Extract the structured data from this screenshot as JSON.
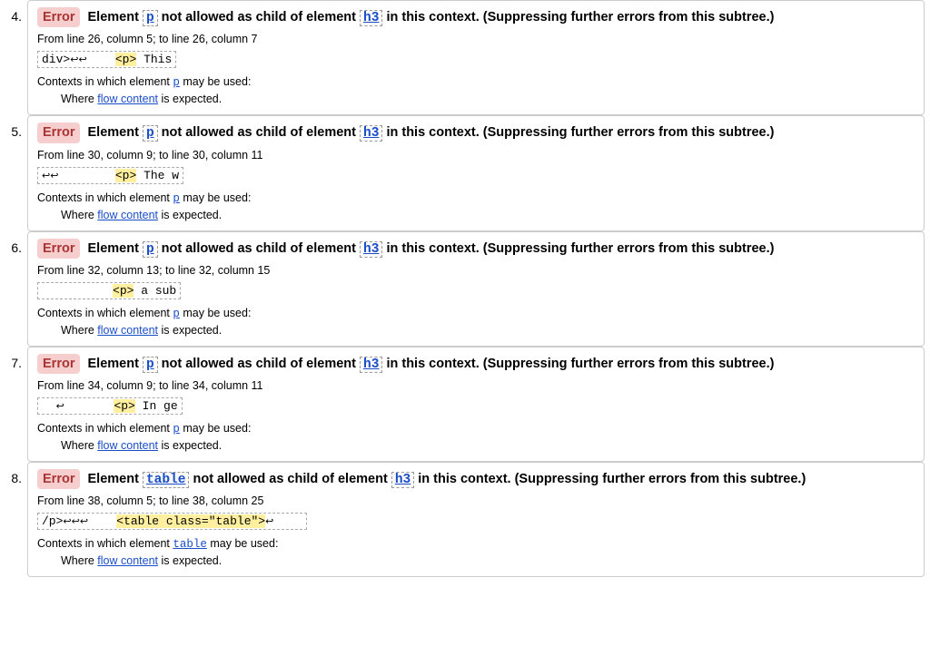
{
  "labels": {
    "error": "Error",
    "contexts_prefix": "Contexts in which element ",
    "contexts_suffix": " may be used:",
    "where": "Where ",
    "flow_content": "flow content",
    "is_expected": " is expected."
  },
  "msg_template": {
    "t1": "Element ",
    "t2": " not allowed as child of element ",
    "t3": " in this context. (Suppressing further errors from this subtree.)"
  },
  "items": [
    {
      "num": "4.",
      "el1": "p",
      "el2": "h3",
      "loc": "From line 26, column 5; to line 26, column 7",
      "extract_pre": "div>↩↩    ",
      "extract_hl": "<p>",
      "extract_post": " This",
      "ctx_el": "p"
    },
    {
      "num": "5.",
      "el1": "p",
      "el2": "h3",
      "loc": "From line 30, column 9; to line 30, column 11",
      "extract_pre": "↩↩        ",
      "extract_hl": "<p>",
      "extract_post": " The w",
      "ctx_el": "p"
    },
    {
      "num": "6.",
      "el1": "p",
      "el2": "h3",
      "loc": "From line 32, column 13; to line 32, column 15",
      "extract_pre": "          ",
      "extract_hl": "<p>",
      "extract_post": " a sub",
      "ctx_el": "p"
    },
    {
      "num": "7.",
      "el1": "p",
      "el2": "h3",
      "loc": "From line 34, column 9; to line 34, column 11",
      "extract_pre": "  ↩       ",
      "extract_hl": "<p>",
      "extract_post": " In ge",
      "ctx_el": "p"
    },
    {
      "num": "8.",
      "el1": "table",
      "el2": "h3",
      "loc": "From line 38, column 5; to line 38, column 25",
      "extract_pre": "/p>↩↩↩    ",
      "extract_hl": "<table class=\"table\">",
      "extract_post": "↩    ",
      "ctx_el": "table"
    }
  ]
}
